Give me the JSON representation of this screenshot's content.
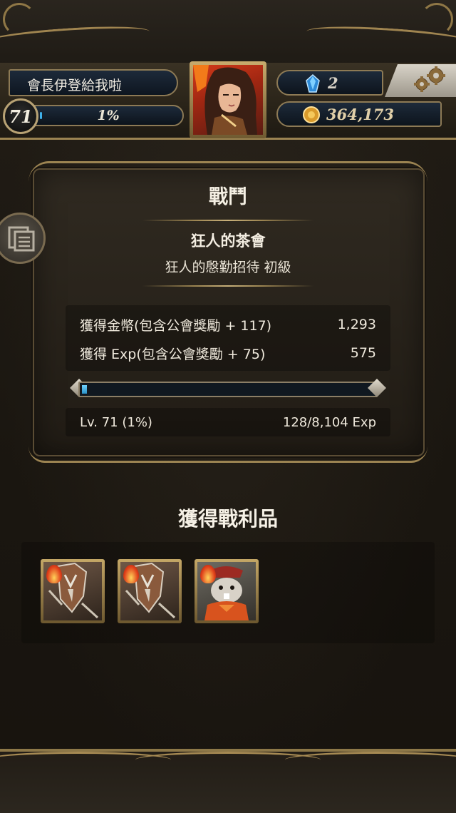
{
  "header": {
    "player_name": "會長伊登給我啦",
    "level": "71",
    "xp_percent_text": "1%",
    "xp_fraction": 0.01,
    "gems": "2",
    "coins": "364,173",
    "settings_icon": "gear-icon",
    "gem_icon": "blue-crystal-icon",
    "coin_icon": "gold-coin-icon"
  },
  "result": {
    "title": "戰鬥",
    "quest_name": "狂人的茶會",
    "quest_subtitle": "狂人的慇勤招待 初級",
    "gold_label": "獲得金幣(包含公會獎勵 + 117)",
    "gold_value": "1,293",
    "exp_label": "獲得 Exp(包含公會獎勵 + 75)",
    "exp_value": "575",
    "exp_bar_fraction": 0.016,
    "level_text": "Lv. 71 (1%)",
    "exp_progress_text": "128/8,104 Exp"
  },
  "loot": {
    "title": "獲得戰利品",
    "items": [
      {
        "kind": "armored-knight-card",
        "element_icon": "fire-element-icon"
      },
      {
        "kind": "armored-knight-card",
        "element_icon": "fire-element-icon"
      },
      {
        "kind": "hamster-card",
        "element_icon": "fire-element-icon"
      }
    ]
  },
  "colors": {
    "accent_gold": "#9c8452",
    "exp_blue": "#3fb1ea",
    "panel_bg": "#2a241b"
  }
}
